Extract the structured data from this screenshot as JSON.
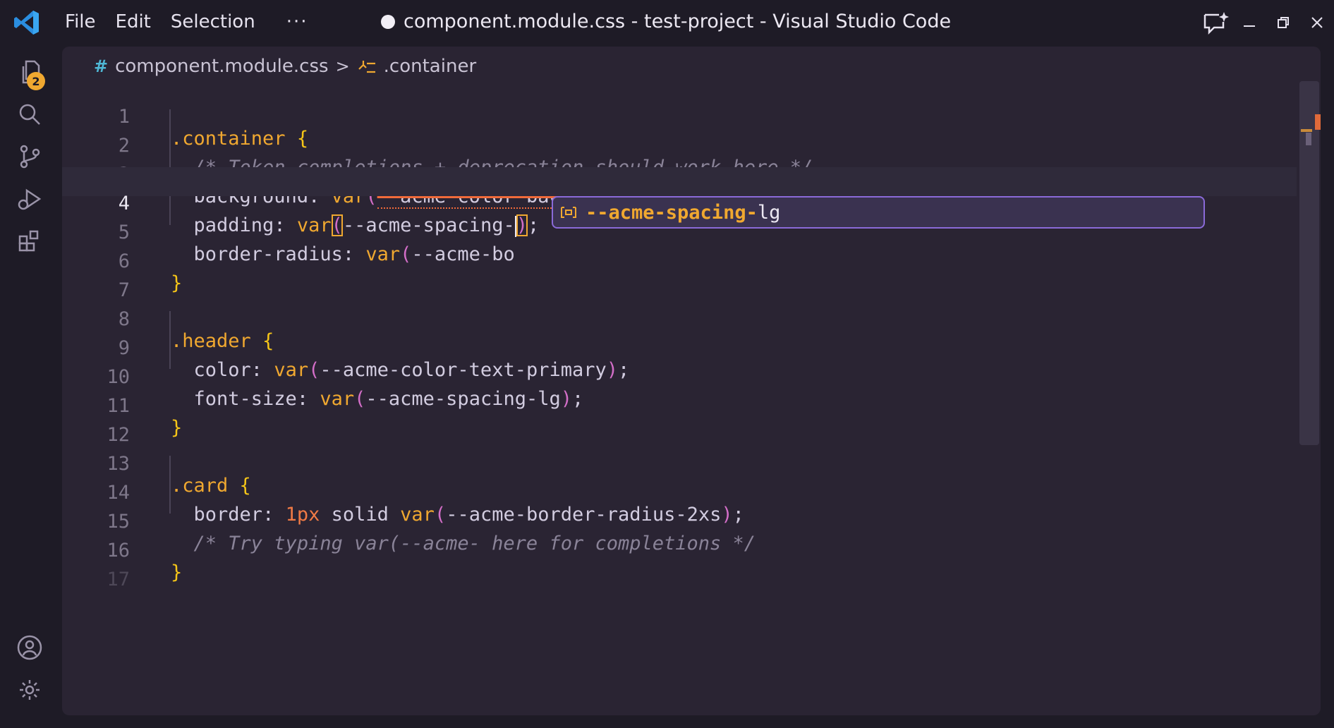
{
  "menu": {
    "file": "File",
    "edit": "Edit",
    "selection": "Selection",
    "more": "···"
  },
  "window": {
    "title": "component.module.css - test-project - Visual Studio Code"
  },
  "activity": {
    "explorer_badge": "2"
  },
  "breadcrumb": {
    "hash": "#",
    "file": "component.module.css",
    "sep": ">",
    "symbol": ".container"
  },
  "lines": {
    "n1": "1",
    "n2": "2",
    "n3": "3",
    "n4": "4",
    "n5": "5",
    "n6": "6",
    "n7": "7",
    "n8": "8",
    "n9": "9",
    "n10": "10",
    "n11": "11",
    "n12": "12",
    "n13": "13",
    "n14": "14",
    "n15": "15",
    "n16": "16",
    "n17": "17"
  },
  "code": {
    "l1_sel": ".container",
    "l2_comment": "/* Token completions + deprecation should work here */",
    "l3_prop": "background",
    "l3_var": "--acme-color-background-button-primary-pressed",
    "l4_prop": "padding",
    "l4_var": "--acme-spacing-",
    "l5_prop": "border-radius",
    "l5_var": "--acme-bo",
    "l8_sel": ".header",
    "l9_prop": "color",
    "l9_var": "--acme-color-text-primary",
    "l10_prop": "font-size",
    "l10_var": "--acme-spacing-lg",
    "l13_sel": ".card",
    "l14_prop": "border",
    "l14_num": "1px",
    "l14_kw": "solid",
    "l14_var": "--acme-border-radius-2xs",
    "l15_comment": "/* Try typing var(--acme- here for completions */",
    "brace_open": "{",
    "brace_close": "}",
    "fn": "var",
    "colon": ": ",
    "open_paren": "(",
    "close_paren": ")",
    "semi": ";"
  },
  "suggest": {
    "match": "--acme-spacing-",
    "rest": "lg"
  },
  "colors": {
    "accent": "#f0a830",
    "suggest_border": "#8a6ad8",
    "deprecated": "#f06a3a"
  }
}
